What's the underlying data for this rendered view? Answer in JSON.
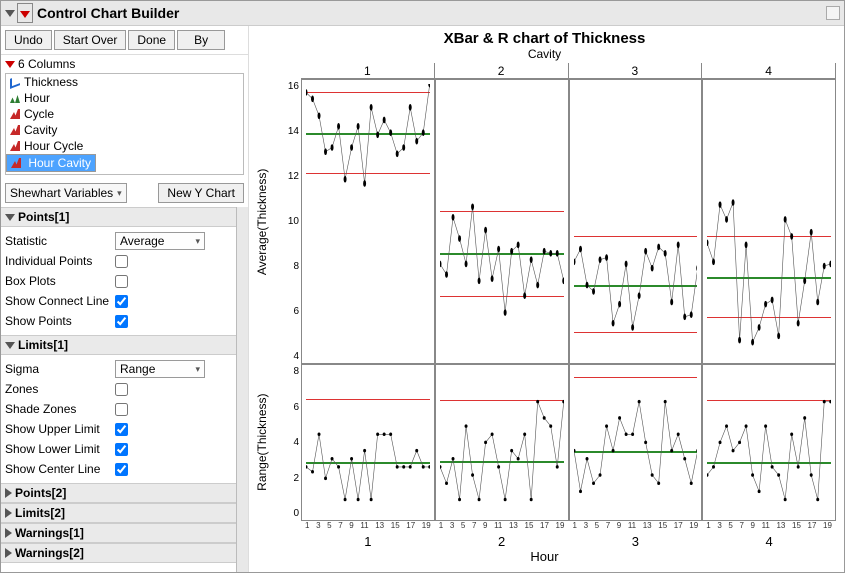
{
  "title": "Control Chart Builder",
  "toolbar": {
    "undo": "Undo",
    "start_over": "Start Over",
    "done": "Done",
    "by": "By"
  },
  "columns_header": "6 Columns",
  "columns": [
    {
      "name": "Thickness",
      "type": "cont"
    },
    {
      "name": "Hour",
      "type": "ord"
    },
    {
      "name": "Cycle",
      "type": "nom"
    },
    {
      "name": "Cavity",
      "type": "nom"
    },
    {
      "name": "Hour Cycle",
      "type": "nom"
    },
    {
      "name": "Hour Cavity",
      "type": "nom",
      "selected": true
    }
  ],
  "shewhart_label": "Shewhart Variables",
  "new_y": "New Y Chart",
  "sections": {
    "points1": "Points[1]",
    "limits1": "Limits[1]",
    "points2": "Points[2]",
    "limits2": "Limits[2]",
    "warnings1": "Warnings[1]",
    "warnings2": "Warnings[2]"
  },
  "points1": {
    "statistic_label": "Statistic",
    "statistic_value": "Average",
    "individual": "Individual Points",
    "boxplots": "Box Plots",
    "connect": "Show Connect Line",
    "showpoints": "Show Points"
  },
  "limits1": {
    "sigma_label": "Sigma",
    "sigma_value": "Range",
    "zones": "Zones",
    "shade": "Shade Zones",
    "upper": "Show Upper Limit",
    "lower": "Show Lower Limit",
    "center": "Show Center Line"
  },
  "chart": {
    "title": "XBar & R chart of Thickness",
    "cavity_label": "Cavity",
    "cavities": [
      "1",
      "2",
      "3",
      "4"
    ],
    "ylabel_top": "Average(Thickness)",
    "ylabel_bot": "Range(Thickness)",
    "xlabel": "Hour",
    "top_ymin": 4,
    "top_ymax": 17,
    "bot_ymin": 0,
    "bot_ymax": 9,
    "xticks": [
      "1",
      "3",
      "5",
      "7",
      "9",
      "11",
      "13",
      "15",
      "17",
      "19"
    ]
  },
  "chart_data": {
    "type": "xbar_r_panel",
    "x_variable": "Hour",
    "y_variable": "Thickness",
    "panel_variable": "Cavity",
    "x_values": [
      1,
      2,
      3,
      4,
      5,
      6,
      7,
      8,
      9,
      10,
      11,
      12,
      13,
      14,
      15,
      16,
      17,
      18,
      19,
      20
    ],
    "top": {
      "statistic": "Average",
      "ylim": [
        4,
        17
      ],
      "panels": [
        {
          "cavity": "1",
          "center": 14.7,
          "ucl": 16.6,
          "lcl": 12.8,
          "values": [
            16.6,
            16.3,
            15.5,
            13.8,
            14.0,
            15.0,
            12.5,
            14.0,
            15.0,
            12.3,
            15.9,
            14.6,
            15.3,
            14.7,
            13.7,
            14.0,
            15.9,
            14.3,
            14.7,
            17.0
          ]
        },
        {
          "cavity": "2",
          "center": 9.0,
          "ucl": 11.0,
          "lcl": 7.0,
          "values": [
            8.5,
            8.0,
            10.7,
            9.7,
            8.5,
            11.2,
            7.7,
            10.1,
            7.8,
            9.2,
            6.2,
            9.1,
            9.4,
            7.0,
            8.7,
            7.5,
            9.1,
            9.0,
            9.0,
            7.7
          ]
        },
        {
          "cavity": "3",
          "center": 7.5,
          "ucl": 9.8,
          "lcl": 5.3,
          "values": [
            8.6,
            9.2,
            7.5,
            7.2,
            8.7,
            8.8,
            5.7,
            6.6,
            8.5,
            5.5,
            7.0,
            9.1,
            8.3,
            9.3,
            9.0,
            6.7,
            9.4,
            6.0,
            6.1,
            8.3
          ]
        },
        {
          "cavity": "4",
          "center": 7.9,
          "ucl": 9.8,
          "lcl": 6.0,
          "values": [
            9.5,
            8.6,
            11.3,
            10.6,
            11.4,
            4.9,
            9.4,
            4.8,
            5.5,
            6.6,
            6.8,
            5.1,
            10.6,
            9.8,
            5.7,
            7.7,
            10.0,
            6.7,
            8.4,
            8.5
          ]
        }
      ]
    },
    "bottom": {
      "statistic": "Range",
      "ylim": [
        0,
        9
      ],
      "panels": [
        {
          "cavity": "1",
          "center": 3.3,
          "ucl": 7.2,
          "values": [
            3.0,
            2.7,
            5.0,
            2.3,
            3.5,
            3.0,
            1.0,
            3.5,
            1.0,
            4.0,
            1.0,
            5.0,
            5.0,
            5.0,
            3.0,
            3.0,
            3.0,
            4.0,
            3.0,
            3.0
          ]
        },
        {
          "cavity": "2",
          "center": 3.4,
          "ucl": 7.1,
          "values": [
            3.0,
            2.0,
            3.5,
            1.0,
            5.5,
            2.5,
            1.0,
            4.5,
            5.0,
            3.0,
            1.0,
            4.0,
            3.5,
            5.0,
            1.0,
            7.0,
            6.0,
            5.5,
            3.0,
            7.0
          ]
        },
        {
          "cavity": "3",
          "center": 4.0,
          "ucl": 8.5,
          "values": [
            4.0,
            1.5,
            3.5,
            2.0,
            2.5,
            5.5,
            4.0,
            6.0,
            5.0,
            5.0,
            7.0,
            4.5,
            2.5,
            2.0,
            7.0,
            4.0,
            5.0,
            3.5,
            2.0,
            4.0
          ]
        },
        {
          "cavity": "4",
          "center": 3.3,
          "ucl": 7.1,
          "values": [
            2.5,
            3.0,
            4.5,
            5.5,
            4.0,
            4.5,
            5.5,
            2.5,
            1.5,
            5.5,
            3.0,
            2.5,
            1.0,
            5.0,
            3.0,
            6.0,
            2.5,
            1.0,
            7.0,
            7.0
          ]
        }
      ]
    }
  }
}
